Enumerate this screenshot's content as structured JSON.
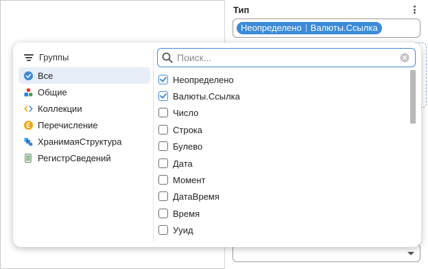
{
  "background": {
    "type_label": "Тип",
    "type_chips": [
      "Неопределено",
      "Валюты.Ссылка"
    ]
  },
  "popup": {
    "groups_header": "Группы",
    "groups": [
      {
        "label": "Все",
        "icon": "check-circle-icon",
        "selected": true
      },
      {
        "label": "Общие",
        "icon": "shapes-icon",
        "selected": false
      },
      {
        "label": "Коллекции",
        "icon": "angle-brackets-icon",
        "selected": false
      },
      {
        "label": "Перечисление",
        "icon": "enum-e-icon",
        "selected": false
      },
      {
        "label": "ХранимаяСтруктура",
        "icon": "stored-structure-icon",
        "selected": false
      },
      {
        "label": "РегистрСведений",
        "icon": "register-icon",
        "selected": false
      }
    ],
    "search": {
      "placeholder": "Поиск...",
      "value": ""
    },
    "types": [
      {
        "label": "Неопределено",
        "checked": true
      },
      {
        "label": "Валюты.Ссылка",
        "checked": true
      },
      {
        "label": "Число",
        "checked": false
      },
      {
        "label": "Строка",
        "checked": false
      },
      {
        "label": "Булево",
        "checked": false
      },
      {
        "label": "Дата",
        "checked": false
      },
      {
        "label": "Момент",
        "checked": false
      },
      {
        "label": "ДатаВремя",
        "checked": false
      },
      {
        "label": "Время",
        "checked": false
      },
      {
        "label": "Ууид",
        "checked": false
      }
    ]
  },
  "colors": {
    "accent": "#3d8ad8",
    "selected_bg": "#e6eef7"
  }
}
